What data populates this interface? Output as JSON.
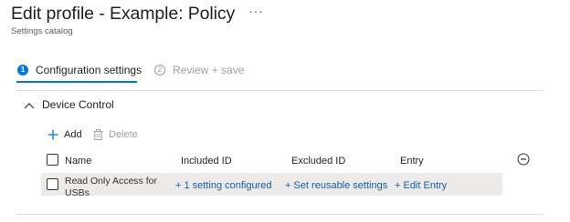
{
  "header": {
    "title": "Edit profile - Example: Policy",
    "more_icon": "ellipsis-icon",
    "more_glyph": "···",
    "subtitle": "Settings catalog"
  },
  "wizard": {
    "steps": [
      {
        "number": "1",
        "label": "Configuration settings",
        "active": true
      },
      {
        "number": "2",
        "label": "Review + save",
        "active": false
      }
    ]
  },
  "section": {
    "title": "Device Control",
    "expanded": true,
    "toggle_icon": "chevron-up-icon"
  },
  "toolbar": {
    "add_label": "Add",
    "add_icon": "plus-icon",
    "delete_label": "Delete",
    "delete_icon": "trash-icon",
    "delete_enabled": false
  },
  "table": {
    "columns": [
      "Name",
      "Included ID",
      "Excluded ID",
      "Entry"
    ],
    "remove_icon": "minus-circle-icon",
    "rows": [
      {
        "name": "Read Only Access for USBs",
        "included_id": "+ 1 setting configured",
        "excluded_id": "+ Set reusable settings",
        "entry": "+ Edit Entry"
      }
    ]
  },
  "colors": {
    "accent": "#0078d4",
    "link": "#0f5fa8",
    "row_background": "#edebe9",
    "divider": "#e1dfdd",
    "muted_text": "#a19f9d"
  }
}
